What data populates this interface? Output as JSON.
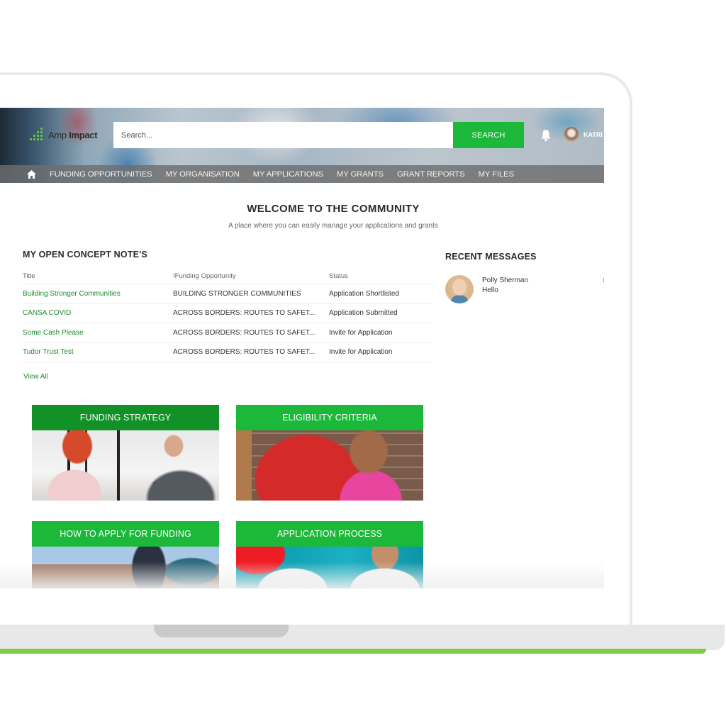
{
  "header": {
    "logo": {
      "light": "Amp",
      "bold": "Impact"
    },
    "search": {
      "placeholder": "Search...",
      "value": ""
    },
    "search_button": "SEARCH",
    "notifications_icon": "bell-icon",
    "user": {
      "name": "KATRI",
      "avatar_icon": "user-avatar"
    }
  },
  "nav": {
    "home_icon": "home-icon",
    "items": [
      {
        "label": "FUNDING OPPORTUNITIES"
      },
      {
        "label": "MY ORGANISATION"
      },
      {
        "label": "MY APPLICATIONS"
      },
      {
        "label": "MY GRANTS"
      },
      {
        "label": "GRANT REPORTS"
      },
      {
        "label": "MY FILES"
      }
    ]
  },
  "welcome": {
    "title": "WELCOME TO THE COMMUNITY",
    "subtitle": "A place where you can easily manage your applications and grants"
  },
  "concept_notes": {
    "title": "MY OPEN CONCEPT NOTE'S",
    "columns": [
      "Title",
      "!Funding Opportunity",
      "Status"
    ],
    "rows": [
      {
        "title": "Building Stronger Communities",
        "opportunity": "BUILDING STRONGER COMMUNITIES",
        "status": "Application Shortlisted"
      },
      {
        "title": "CANSA COVID",
        "opportunity": "ACROSS BORDERS: ROUTES TO SAFET...",
        "status": "Application Submitted"
      },
      {
        "title": "Some Cash Please",
        "opportunity": "ACROSS BORDERS: ROUTES TO SAFET...",
        "status": "Invite for Application"
      },
      {
        "title": "Tudor Trust Test",
        "opportunity": "ACROSS BORDERS: ROUTES TO SAFET...",
        "status": "Invite for Application"
      }
    ],
    "view_all": "View All"
  },
  "recent_messages": {
    "title": "RECENT MESSAGES",
    "items": [
      {
        "name": "Polly Sherman",
        "text": "Hello",
        "count": "1"
      }
    ]
  },
  "tiles": [
    {
      "label": "FUNDING STRATEGY",
      "color": "#129127"
    },
    {
      "label": "ELIGIBILITY CRITERIA",
      "color": "#1cb83a"
    },
    {
      "label": "HOW TO APPLY FOR FUNDING",
      "color": "#1cb83a"
    },
    {
      "label": "APPLICATION PROCESS",
      "color": "#1cb83a"
    }
  ],
  "colors": {
    "accent_green": "#1cb83a",
    "link_green": "#1d8a2e",
    "laptop_stripe": "#7dcd47"
  }
}
